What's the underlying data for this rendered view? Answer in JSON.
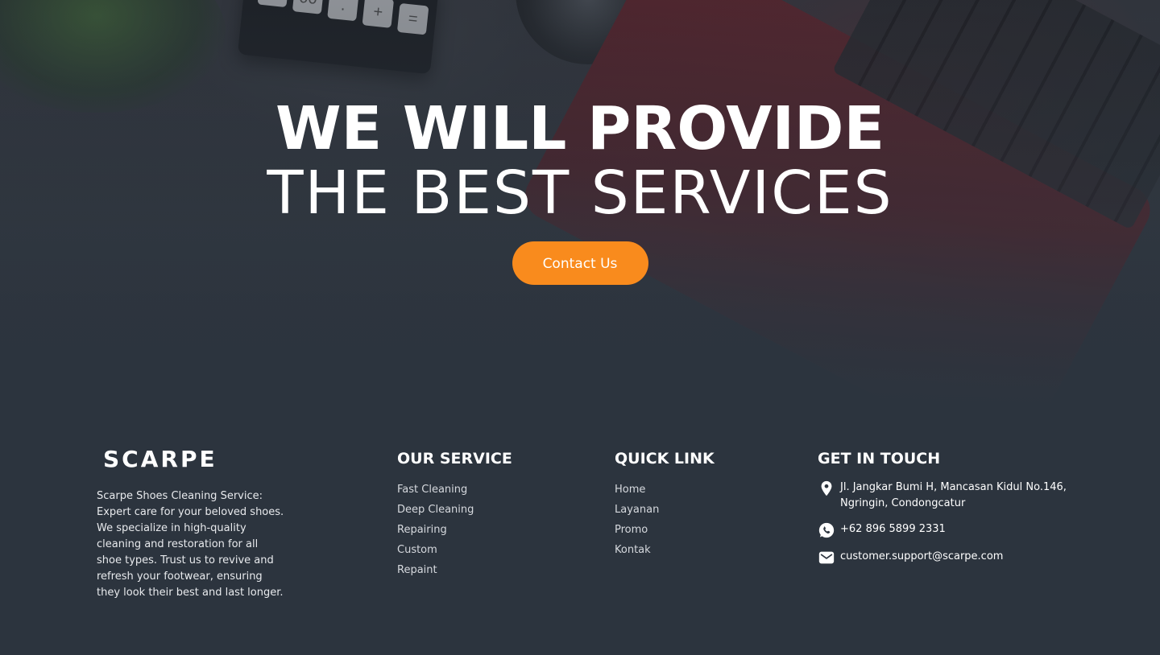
{
  "hero": {
    "title_line1": "WE WILL PROVIDE",
    "title_line2": "THE BEST SERVICES",
    "cta_label": "Contact Us",
    "cta_color": "#f98b1d"
  },
  "footer": {
    "brand": {
      "logo_text": "SCARPE",
      "description": "Scarpe Shoes Cleaning Service: Expert care for your beloved shoes. We specialize in high-quality cleaning and restoration for all shoe types. Trust us to revive and refresh your footwear, ensuring they look their best and last longer."
    },
    "service": {
      "title": "OUR SERVICE",
      "items": [
        "Fast Cleaning",
        "Deep Cleaning",
        "Repairing",
        "Custom",
        "Repaint"
      ]
    },
    "quick_link": {
      "title": "QUICK LINK",
      "items": [
        "Home",
        "Layanan",
        "Promo",
        "Kontak"
      ]
    },
    "contact": {
      "title": "GET IN TOUCH",
      "address": "Jl. Jangkar Bumi H, Mancasan Kidul No.146, Ngringin, Condongcatur",
      "phone": "+62 896 5899 2331",
      "email": "customer.support@scarpe.com",
      "icons": [
        "location-pin-icon",
        "whatsapp-icon",
        "mail-icon"
      ]
    }
  },
  "colors": {
    "background": "#2c343e",
    "accent": "#f98b1d",
    "text": "#ffffff"
  }
}
